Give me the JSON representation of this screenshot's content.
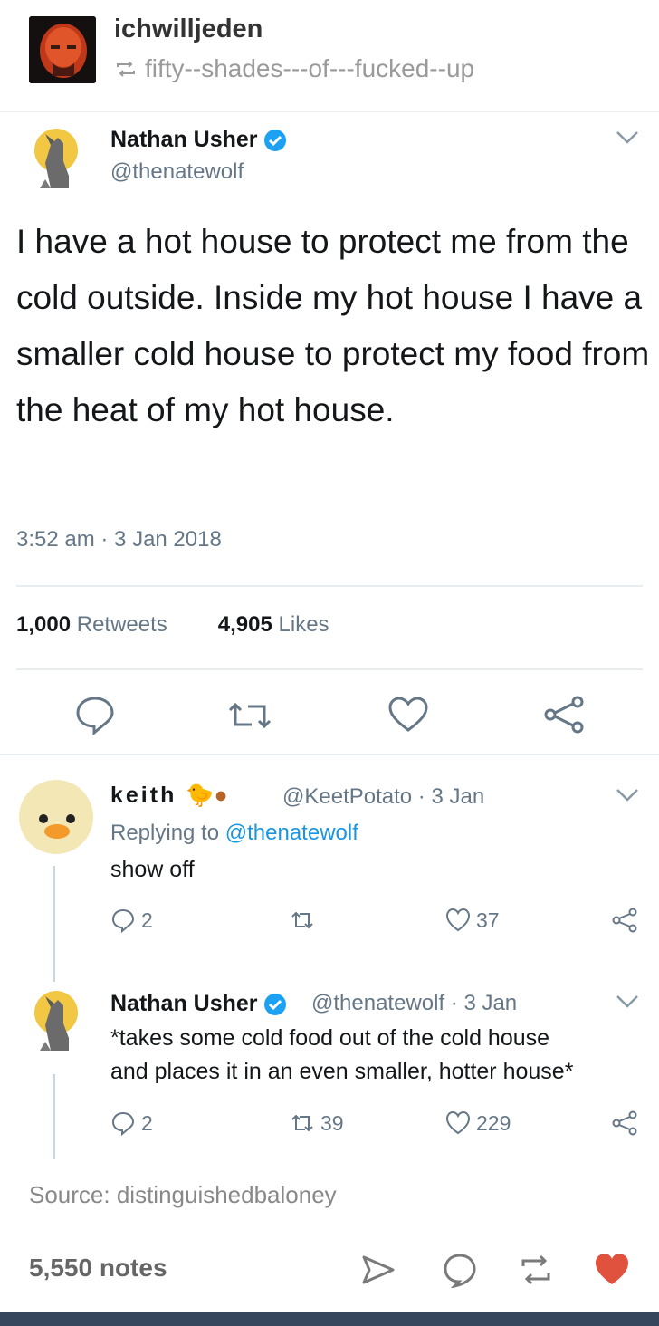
{
  "tumblr": {
    "username": "ichwilljeden",
    "reblogged_from": "fifty--shades---of---fucked--up",
    "source_label": "Source: distinguishedbaloney",
    "notes": "5,550 notes"
  },
  "tweet": {
    "name": "Nathan Usher",
    "handle": "@thenatewolf",
    "text": "I have a hot house to protect me from the cold outside. Inside my hot house I have a smaller cold house to protect my food from the heat of my hot house.",
    "time": "3:52 am · 3 Jan 2018",
    "retweets_count": "1,000",
    "retweets_label": "Retweets",
    "likes_count": "4,905",
    "likes_label": "Likes"
  },
  "replies": [
    {
      "name": "keith",
      "meta": "@KeetPotato · 3 Jan",
      "replying_prefix": "Replying to ",
      "replying_handle": "@thenatewolf",
      "text": "show off",
      "replies": "2",
      "retweets": "",
      "likes": "37"
    },
    {
      "name": "Nathan Usher",
      "meta": "@thenatewolf · 3 Jan",
      "text_line1": "*takes some cold food out of the cold house",
      "text_line2": "and places it in an even smaller, hotter house*",
      "replies": "2",
      "retweets": "39",
      "likes": "229"
    }
  ],
  "colors": {
    "twitter_blue": "#1da1f2",
    "link_blue": "#1b95e0",
    "muted": "#657786",
    "tumblr_like": "#e0523e",
    "tumblr_bar": "#36465d"
  },
  "icons": [
    "reblog-icon",
    "verified-icon",
    "chevron-down-icon",
    "reply-icon",
    "retweet-icon",
    "heart-icon",
    "share-icon",
    "send-icon",
    "comment-icon"
  ]
}
